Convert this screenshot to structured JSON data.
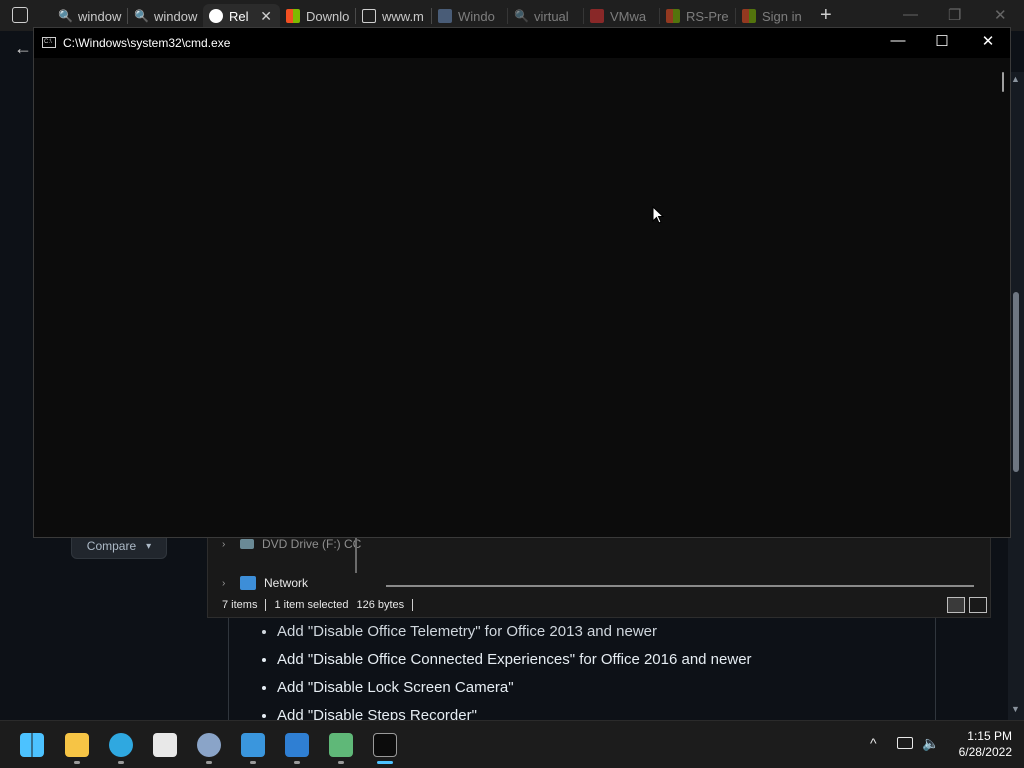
{
  "browser": {
    "tabs": [
      {
        "label": "window",
        "icon": "search-icon",
        "color": "#3b82f6"
      },
      {
        "label": "window",
        "icon": "search-icon",
        "color": "#3b82f6"
      },
      {
        "label": "Rel",
        "icon": "github-icon",
        "color": "#ffffff",
        "active": true
      },
      {
        "label": "Downlo",
        "icon": "microsoft-icon",
        "color": "#f25022"
      },
      {
        "label": "www.m",
        "icon": "document-icon",
        "color": "#cfcfcf"
      },
      {
        "label": "Windo",
        "icon": "s-icon",
        "color": "#6c8ebf"
      },
      {
        "label": "virtual",
        "icon": "search-icon",
        "color": "#3b82f6"
      },
      {
        "label": "VMwa",
        "icon": "vm-icon",
        "color": "#e03131"
      },
      {
        "label": "RS-Pre",
        "icon": "microsoft-icon",
        "color": "#f25022"
      },
      {
        "label": "Sign in",
        "icon": "microsoft-icon",
        "color": "#f25022"
      }
    ],
    "new_tab": "+",
    "min": "—",
    "restore": "❐",
    "close": "✕"
  },
  "page": {
    "back": "←",
    "compare_label": "Compare",
    "compare_caret": "▾",
    "list": [
      "Add \"Disable Office Telemetry\" for Office 2013 and newer",
      "Add \"Disable Office Connected Experiences\" for Office 2016 and newer",
      "Add \"Disable Lock Screen Camera\"",
      "Add \"Disable Steps Recorder\""
    ]
  },
  "explorer": {
    "dvd_label": "DVD Drive (F:) CC",
    "network_label": "Network",
    "status_items": "7 items",
    "status_selected": "1 item selected",
    "status_size": "126 bytes"
  },
  "cmd": {
    "title": "C:\\Windows\\system32\\cmd.exe",
    "icon_text": "C:\\",
    "min": "—",
    "max": "☐",
    "close": "✕"
  },
  "taskbar": {
    "icons": [
      {
        "name": "start-icon",
        "color": "#4cc2ff"
      },
      {
        "name": "file-explorer-icon",
        "color": "#f6c445"
      },
      {
        "name": "edge-icon",
        "color": "#2fa8e0"
      },
      {
        "name": "store-icon",
        "color": "#e8e8e8"
      },
      {
        "name": "settings-icon",
        "color": "#8aa4c8"
      },
      {
        "name": "notepad-icon",
        "color": "#3a96dd"
      },
      {
        "name": "photos-icon",
        "color": "#2f7fd3"
      },
      {
        "name": "app-icon",
        "color": "#5fb878"
      },
      {
        "name": "cmd-icon",
        "color": "#0c0c0c"
      }
    ],
    "tray_chevron": "^",
    "time": "1:15 PM",
    "date": "6/28/2022"
  }
}
